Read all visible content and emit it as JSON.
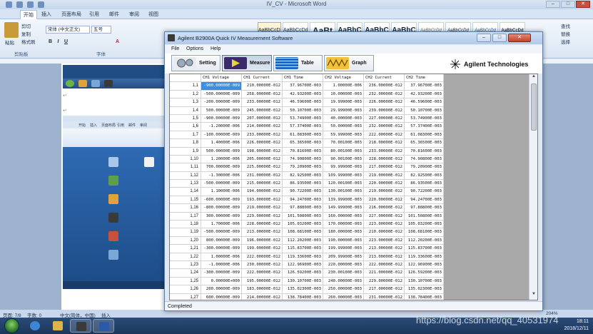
{
  "word": {
    "title": "IV_CV - Microsoft Word",
    "tabs": [
      "开始",
      "插入",
      "页面布局",
      "引用",
      "邮件",
      "审阅",
      "视图"
    ],
    "clipboard": {
      "paste": "粘贴",
      "cut": "剪切",
      "copy": "复制",
      "format_painter": "格式刷",
      "group": "剪贴板"
    },
    "font": {
      "name": "宋体 (中文正文)",
      "size": "五号",
      "group": "字体"
    },
    "styles": [
      "AaBbCcDd",
      "AaBbCcDd",
      "AaBt",
      "AaBbC",
      "AaBbC",
      "AaBbC",
      "AaBbCcDd",
      "AaBbCcDd",
      "AaBbCcDd",
      "AaBbCcDd"
    ],
    "editing": {
      "find": "查找",
      "replace": "替换",
      "select": "选择"
    },
    "status": {
      "page": "页面: 7/8",
      "words": "字数: 0",
      "lang": "中文(简体，中国)",
      "insert": "插入",
      "zoom": "204%"
    }
  },
  "taskbar": {
    "time": "18:11",
    "date": "2018/12/11"
  },
  "watermark": "https://blog.csdn.net/qq_40531974",
  "app": {
    "title": "Agilent B2900A Quick IV Measurement Software",
    "menu": [
      "File",
      "Options",
      "Help"
    ],
    "toolbar": [
      {
        "label": "Setting",
        "icon": "gears-icon"
      },
      {
        "label": "Measure",
        "icon": "play-icon"
      },
      {
        "label": "Table",
        "icon": "table-icon"
      },
      {
        "label": "Graph",
        "icon": "graph-icon"
      }
    ],
    "brand": "Agilent Technologies",
    "status": "Completed",
    "columns": [
      "",
      "CH1 Voltage",
      "CH1 Current",
      "CH1 Time",
      "CH2 Voltage",
      "CH2 Current",
      "CH2 Time"
    ],
    "rows": [
      [
        "1,1",
        "-900.00000E-009",
        "210.00000E-012",
        "37.96700E-003",
        "1.00000E-006",
        "236.00000E-012",
        "37.96700E-003"
      ],
      [
        "1,2",
        "-500.00000E-009",
        "258.00000E-012",
        "42.93200E-003",
        "10.00000E-003",
        "232.00000E-012",
        "42.93200E-003"
      ],
      [
        "1,3",
        "-200.00000E-009",
        "233.00000E-012",
        "46.59600E-003",
        "19.99900E-003",
        "226.00000E-012",
        "46.59600E-003"
      ],
      [
        "1,4",
        "500.00000E-009",
        "245.00000E-012",
        "50.10700E-003",
        "29.99900E-003",
        "239.00000E-012",
        "50.10700E-003"
      ],
      [
        "1,5",
        "-900.00000E-009",
        "207.00000E-012",
        "53.74900E-003",
        "40.00000E-003",
        "227.00000E-012",
        "53.74900E-003"
      ],
      [
        "1,6",
        "-1.20000E-006",
        "214.00000E-012",
        "57.37400E-003",
        "50.00000E-003",
        "232.00000E-012",
        "57.37400E-003"
      ],
      [
        "1,7",
        "-100.00000E-009",
        "233.00000E-012",
        "61.08300E-003",
        "59.99900E-003",
        "222.00000E-012",
        "61.08300E-003"
      ],
      [
        "1,8",
        "1.40000E-006",
        "226.00000E-012",
        "65.36500E-003",
        "70.00100E-003",
        "218.00000E-012",
        "65.36500E-003"
      ],
      [
        "1,9",
        "500.00000E-009",
        "198.00000E-012",
        "70.81600E-003",
        "80.00100E-003",
        "233.00000E-012",
        "70.81600E-003"
      ],
      [
        "1,10",
        "1.20000E-006",
        "205.00000E-012",
        "74.90800E-003",
        "90.00100E-003",
        "228.00000E-012",
        "74.90800E-003"
      ],
      [
        "1,11",
        "700.00000E-009",
        "225.00000E-012",
        "79.20900E-003",
        "99.99900E-003",
        "217.00000E-012",
        "79.20900E-003"
      ],
      [
        "1,12",
        "-1.30000E-006",
        "231.00000E-012",
        "82.92500E-003",
        "109.99900E-003",
        "219.00000E-012",
        "82.92500E-003"
      ],
      [
        "1,13",
        "-500.00000E-009",
        "215.00000E-012",
        "86.93500E-003",
        "120.00100E-003",
        "220.00000E-012",
        "86.93500E-003"
      ],
      [
        "1,14",
        "1.10000E-006",
        "194.00000E-012",
        "90.72200E-003",
        "130.00100E-003",
        "219.00000E-012",
        "90.72200E-003"
      ],
      [
        "1,15",
        "-600.00000E-009",
        "193.00000E-012",
        "94.24700E-003",
        "139.99900E-003",
        "220.00000E-012",
        "94.24700E-003"
      ],
      [
        "1,16",
        "-800.00000E-009",
        "219.00000E-012",
        "97.88800E-003",
        "149.99900E-003",
        "216.00000E-012",
        "97.88800E-003"
      ],
      [
        "1,17",
        "300.00000E-009",
        "229.00000E-012",
        "101.50800E-003",
        "160.00000E-003",
        "227.00000E-012",
        "101.50800E-003"
      ],
      [
        "1,18",
        "1.70000E-006",
        "228.00000E-012",
        "105.03200E-003",
        "170.00000E-003",
        "223.00000E-012",
        "105.03200E-003"
      ],
      [
        "1,19",
        "-500.00000E-009",
        "213.00000E-012",
        "108.68100E-003",
        "180.00000E-003",
        "210.00000E-012",
        "108.68100E-003"
      ],
      [
        "1,20",
        "800.00000E-009",
        "196.00000E-012",
        "112.20200E-003",
        "190.00000E-003",
        "223.00000E-012",
        "112.20200E-003"
      ],
      [
        "1,21",
        "-300.00000E-009",
        "199.00000E-012",
        "115.83700E-003",
        "199.99900E-003",
        "213.00000E-012",
        "115.83700E-003"
      ],
      [
        "1,22",
        "1.00000E-006",
        "222.00000E-012",
        "119.33600E-003",
        "209.99900E-003",
        "213.00000E-012",
        "119.33600E-003"
      ],
      [
        "1,23",
        "-1.00000E-006",
        "230.00000E-012",
        "122.96900E-003",
        "220.00000E-003",
        "222.00000E-012",
        "122.96900E-003"
      ],
      [
        "1,24",
        "-300.00000E-009",
        "222.00000E-012",
        "126.59200E-003",
        "230.00100E-003",
        "221.00000E-012",
        "126.59200E-003"
      ],
      [
        "1,25",
        "0.00000E+000",
        "195.00000E-012",
        "130.10700E-003",
        "240.00000E-003",
        "229.00000E-012",
        "130.10700E-003"
      ],
      [
        "1,26",
        "200.00000E-009",
        "183.00000E-012",
        "135.02300E-003",
        "250.00000E-003",
        "217.00000E-012",
        "135.02300E-003"
      ],
      [
        "1,27",
        "600.00000E-009",
        "214.00000E-012",
        "138.78400E-003",
        "260.00000E-003",
        "231.00000E-012",
        "138.78400E-003"
      ],
      [
        "1,28",
        "700.00000E-009",
        "233.00000E-012",
        "143.20100E-003",
        "270.00100E-003",
        "226.00000E-012",
        "143.20100E-003"
      ]
    ]
  },
  "colors": {
    "accent": "#3b8fe0",
    "titlebar": "#b2cbe9",
    "close": "#c1432b"
  }
}
